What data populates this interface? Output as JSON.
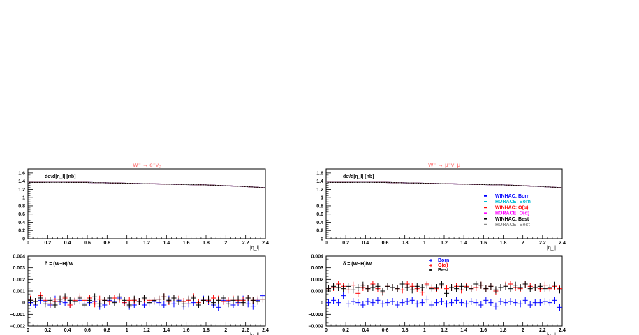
{
  "colors": {
    "winhac_born": "#0000ff",
    "horace_born": "#00bcd4",
    "winhac_oa": "#ff0000",
    "horace_oa": "#ff00ff",
    "winhac_best": "#000000",
    "horace_best": "#8b8b8b",
    "title": "#ff6666"
  },
  "chart_data": [
    {
      "type": "line",
      "title": "W⁻ → e⁻ν̄ₑ",
      "ylabel": "dσ/d|η_l| [nb]",
      "xlabel": "|η_l|",
      "xlim": [
        0,
        2.4
      ],
      "ylim": [
        0,
        1.7
      ],
      "x_ticks": [
        "0",
        "0.2",
        "0.4",
        "0.6",
        "0.8",
        "1",
        "1.2",
        "1.4",
        "1.6",
        "1.8",
        "2",
        "2.2",
        "2.4"
      ],
      "y_ticks": [
        "0",
        "0.2",
        "0.4",
        "0.6",
        "0.8",
        "1",
        "1.2",
        "1.4",
        "1.6"
      ],
      "x": [
        0.0,
        0.2,
        0.4,
        0.6,
        0.8,
        1.0,
        1.2,
        1.4,
        1.6,
        1.8,
        2.0,
        2.2,
        2.4
      ],
      "series": [
        {
          "name": "WINHAC: Born",
          "values": [
            1.37,
            1.37,
            1.37,
            1.37,
            1.36,
            1.35,
            1.34,
            1.33,
            1.32,
            1.31,
            1.29,
            1.27,
            1.24
          ]
        },
        {
          "name": "HORACE: Born",
          "values": [
            1.37,
            1.37,
            1.37,
            1.37,
            1.36,
            1.35,
            1.34,
            1.33,
            1.32,
            1.31,
            1.29,
            1.27,
            1.24
          ]
        },
        {
          "name": "WINHAC: O(α)",
          "values": [
            1.37,
            1.37,
            1.37,
            1.37,
            1.36,
            1.35,
            1.34,
            1.33,
            1.32,
            1.31,
            1.29,
            1.27,
            1.24
          ]
        },
        {
          "name": "HORACE: O(α)",
          "values": [
            1.37,
            1.37,
            1.37,
            1.37,
            1.36,
            1.35,
            1.34,
            1.33,
            1.32,
            1.31,
            1.29,
            1.27,
            1.24
          ]
        },
        {
          "name": "WINHAC: Best",
          "values": [
            1.37,
            1.37,
            1.37,
            1.37,
            1.36,
            1.35,
            1.34,
            1.33,
            1.32,
            1.31,
            1.29,
            1.27,
            1.24
          ]
        },
        {
          "name": "HORACE: Best",
          "values": [
            1.37,
            1.37,
            1.37,
            1.37,
            1.36,
            1.35,
            1.34,
            1.33,
            1.32,
            1.31,
            1.29,
            1.27,
            1.24
          ]
        }
      ]
    },
    {
      "type": "line",
      "title": "W⁻ → μ⁻ν̄_μ",
      "ylabel": "dσ/d|η_l| [nb]",
      "xlabel": "|η_l|",
      "xlim": [
        0,
        2.4
      ],
      "ylim": [
        0,
        1.7
      ],
      "x_ticks": [
        "0",
        "0.2",
        "0.4",
        "0.6",
        "0.8",
        "1",
        "1.2",
        "1.4",
        "1.6",
        "1.8",
        "2",
        "2.2",
        "2.4"
      ],
      "y_ticks": [
        "0",
        "0.2",
        "0.4",
        "0.6",
        "0.8",
        "1",
        "1.2",
        "1.4",
        "1.6"
      ],
      "x": [
        0.0,
        0.2,
        0.4,
        0.6,
        0.8,
        1.0,
        1.2,
        1.4,
        1.6,
        1.8,
        2.0,
        2.2,
        2.4
      ],
      "legend": [
        "WINHAC: Born",
        "HORACE: Born",
        "WINHAC: O(α)",
        "HORACE: O(α)",
        "WINHAC: Best",
        "HORACE: Best"
      ],
      "legend_position": "bottom-right",
      "series": [
        {
          "name": "WINHAC: Born",
          "values": [
            1.37,
            1.37,
            1.37,
            1.37,
            1.36,
            1.35,
            1.34,
            1.33,
            1.32,
            1.31,
            1.29,
            1.27,
            1.24
          ]
        },
        {
          "name": "HORACE: Born",
          "values": [
            1.37,
            1.37,
            1.37,
            1.37,
            1.36,
            1.35,
            1.34,
            1.33,
            1.32,
            1.31,
            1.29,
            1.27,
            1.24
          ]
        },
        {
          "name": "WINHAC: O(α)",
          "values": [
            1.37,
            1.37,
            1.37,
            1.37,
            1.36,
            1.35,
            1.34,
            1.33,
            1.32,
            1.31,
            1.29,
            1.27,
            1.24
          ]
        },
        {
          "name": "HORACE: O(α)",
          "values": [
            1.37,
            1.37,
            1.37,
            1.37,
            1.36,
            1.35,
            1.34,
            1.33,
            1.32,
            1.31,
            1.29,
            1.27,
            1.24
          ]
        },
        {
          "name": "WINHAC: Best",
          "values": [
            1.37,
            1.37,
            1.37,
            1.37,
            1.36,
            1.35,
            1.34,
            1.33,
            1.32,
            1.31,
            1.29,
            1.27,
            1.24
          ]
        },
        {
          "name": "HORACE: Best",
          "values": [
            1.37,
            1.37,
            1.37,
            1.37,
            1.36,
            1.35,
            1.34,
            1.33,
            1.32,
            1.31,
            1.29,
            1.27,
            1.24
          ]
        }
      ]
    },
    {
      "type": "scatter",
      "title": "",
      "ylabel": "δ = (W−H)/W",
      "xlabel": "|η_l|",
      "xlim": [
        0,
        2.4
      ],
      "ylim": [
        -0.002,
        0.004
      ],
      "x_ticks": [
        "0",
        "0.2",
        "0.4",
        "0.6",
        "0.8",
        "1",
        "1.2",
        "1.4",
        "1.6",
        "1.8",
        "2",
        "2.2",
        "2.4"
      ],
      "y_ticks": [
        "−0.002",
        "−0.001",
        "0",
        "0.001",
        "0.002",
        "0.003",
        "0.004"
      ],
      "bin_width": 0.05,
      "series": [
        {
          "name": "Born",
          "values": [
            0.0,
            -0.0002,
            0.0002,
            0.0001,
            -0.0002,
            0.0003,
            0.0001,
            0.0,
            -0.0002,
            0.0001,
            0.0002,
            -0.0001,
            0.0,
            0.0001,
            -0.0003,
            -0.0002,
            0.0002,
            0.0001,
            0.0004,
            0.0,
            -0.0003,
            -0.0002,
            0.0001,
            -0.0002,
            -0.0001,
            0.0001,
            0.0,
            -0.0002,
            0.0003,
            -0.0001,
            0.0002,
            -0.0003,
            -0.0001,
            0.0,
            -0.0002,
            0.0003,
            0.0001,
            -0.0002,
            -0.0004,
            0.0002,
            0.0001,
            -0.0002,
            0.0,
            0.0003,
            -0.0001,
            -0.0003,
            0.0002,
            0.0006
          ]
        },
        {
          "name": "O(α)",
          "values": [
            0.0003,
            0.0001,
            0.0006,
            0.0002,
            -0.0001,
            0.0001,
            0.0003,
            0.0004,
            -0.0002,
            0.0002,
            0.0005,
            0.0002,
            0.0004,
            -0.0001,
            0.0003,
            0.0002,
            0.0001,
            0.0004,
            0.0003,
            0.0,
            0.0002,
            0.0002,
            0.0001,
            0.0003,
            0.0002,
            0.0002,
            0.0003,
            0.0005,
            0.0001,
            0.0004,
            0.0003,
            0.0001,
            0.0002,
            0.0005,
            0.0,
            0.0002,
            0.0002,
            0.0004,
            0.0003,
            0.0001,
            0.0002,
            0.0003,
            0.0002,
            0.0002,
            0.0004,
            0.0002,
            0.0003,
            0.0003
          ]
        },
        {
          "name": "Best",
          "values": [
            0.0002,
            0.0001,
            0.0004,
            -0.0001,
            0.0002,
            -0.0002,
            0.0003,
            0.0005,
            0.0002,
            0.0001,
            0.0004,
            -0.0002,
            0.0002,
            0.0005,
            -0.0001,
            0.0002,
            0.0004,
            0.0,
            0.0005,
            0.0002,
            -0.0002,
            0.0003,
            0.0001,
            0.0004,
            0.0,
            0.0002,
            0.0003,
            0.0005,
            0.0002,
            0.0004,
            0.0001,
            -0.0001,
            0.0003,
            0.0004,
            -0.0002,
            0.0002,
            0.0003,
            0.0,
            0.0002,
            0.0004,
            -0.0001,
            0.0002,
            0.0003,
            0.0,
            0.0004,
            0.0002,
            0.0001,
            0.0003
          ]
        }
      ]
    },
    {
      "type": "scatter",
      "title": "",
      "ylabel": "δ = (W−H)/W",
      "xlabel": "|η_l|",
      "xlim": [
        0,
        2.4
      ],
      "ylim": [
        -0.002,
        0.004
      ],
      "x_ticks": [
        "0",
        "0.2",
        "0.4",
        "0.6",
        "0.8",
        "1",
        "1.2",
        "1.4",
        "1.6",
        "1.8",
        "2",
        "2.2",
        "2.4"
      ],
      "y_ticks": [
        "−0.002",
        "−0.001",
        "0",
        "0.001",
        "0.002",
        "0.003",
        "0.004"
      ],
      "bin_width": 0.05,
      "legend": [
        "Born",
        "O(α)",
        "Best"
      ],
      "legend_position": "top-center",
      "series": [
        {
          "name": "Born",
          "values": [
            0.0,
            0.0002,
            0.0,
            0.0006,
            -0.0001,
            0.0001,
            0.0,
            -0.0002,
            0.0001,
            0.0,
            0.0002,
            -0.0001,
            0.0,
            0.0001,
            -0.0002,
            0.0,
            0.0001,
            0.0002,
            -0.0001,
            0.0,
            0.0003,
            -0.0002,
            0.0,
            0.0001,
            -0.0001,
            0.0,
            0.0002,
            0.0,
            -0.0001,
            0.0001,
            0.0,
            -0.0002,
            0.0002,
            0.0,
            -0.0003,
            0.0001,
            0.0,
            0.0001,
            0.0,
            -0.0001,
            0.0002,
            -0.0002,
            0.0,
            0.0,
            0.0001,
            0.0,
            0.0002,
            -0.0004
          ]
        },
        {
          "name": "O(α)",
          "values": [
            0.0012,
            0.0013,
            0.0016,
            0.0014,
            0.0011,
            0.0015,
            0.0008,
            0.0013,
            0.0012,
            0.0016,
            0.0012,
            0.0009,
            0.0014,
            0.0013,
            0.0012,
            0.0011,
            0.0016,
            0.0014,
            0.0012,
            0.0009,
            0.0016,
            0.0013,
            0.0012,
            0.0015,
            0.0012,
            0.0013,
            0.0014,
            0.0011,
            0.0014,
            0.0012,
            0.0013,
            0.0015,
            0.0012,
            0.0014,
            0.001,
            0.0013,
            0.0015,
            0.0016,
            0.0013,
            0.0012,
            0.0016,
            0.0014,
            0.0013,
            0.0012,
            0.0015,
            0.0012,
            0.0014,
            0.0012
          ]
        },
        {
          "name": "Best",
          "values": [
            0.0012,
            0.0014,
            0.0013,
            0.0012,
            0.0014,
            0.0011,
            0.0013,
            0.0015,
            0.0012,
            0.0013,
            0.0014,
            0.001,
            0.0014,
            0.0013,
            0.0012,
            0.0016,
            0.0013,
            0.0011,
            0.0014,
            0.0013,
            0.0015,
            0.0012,
            0.0013,
            0.0016,
            0.0008,
            0.0013,
            0.0012,
            0.0014,
            0.0013,
            0.0012,
            0.0016,
            0.0015,
            0.0012,
            0.0014,
            0.0011,
            0.0013,
            0.0014,
            0.0012,
            0.0015,
            0.0013,
            0.0016,
            0.0012,
            0.0013,
            0.0014,
            0.0012,
            0.0013,
            0.0015,
            0.0011
          ]
        }
      ]
    }
  ]
}
